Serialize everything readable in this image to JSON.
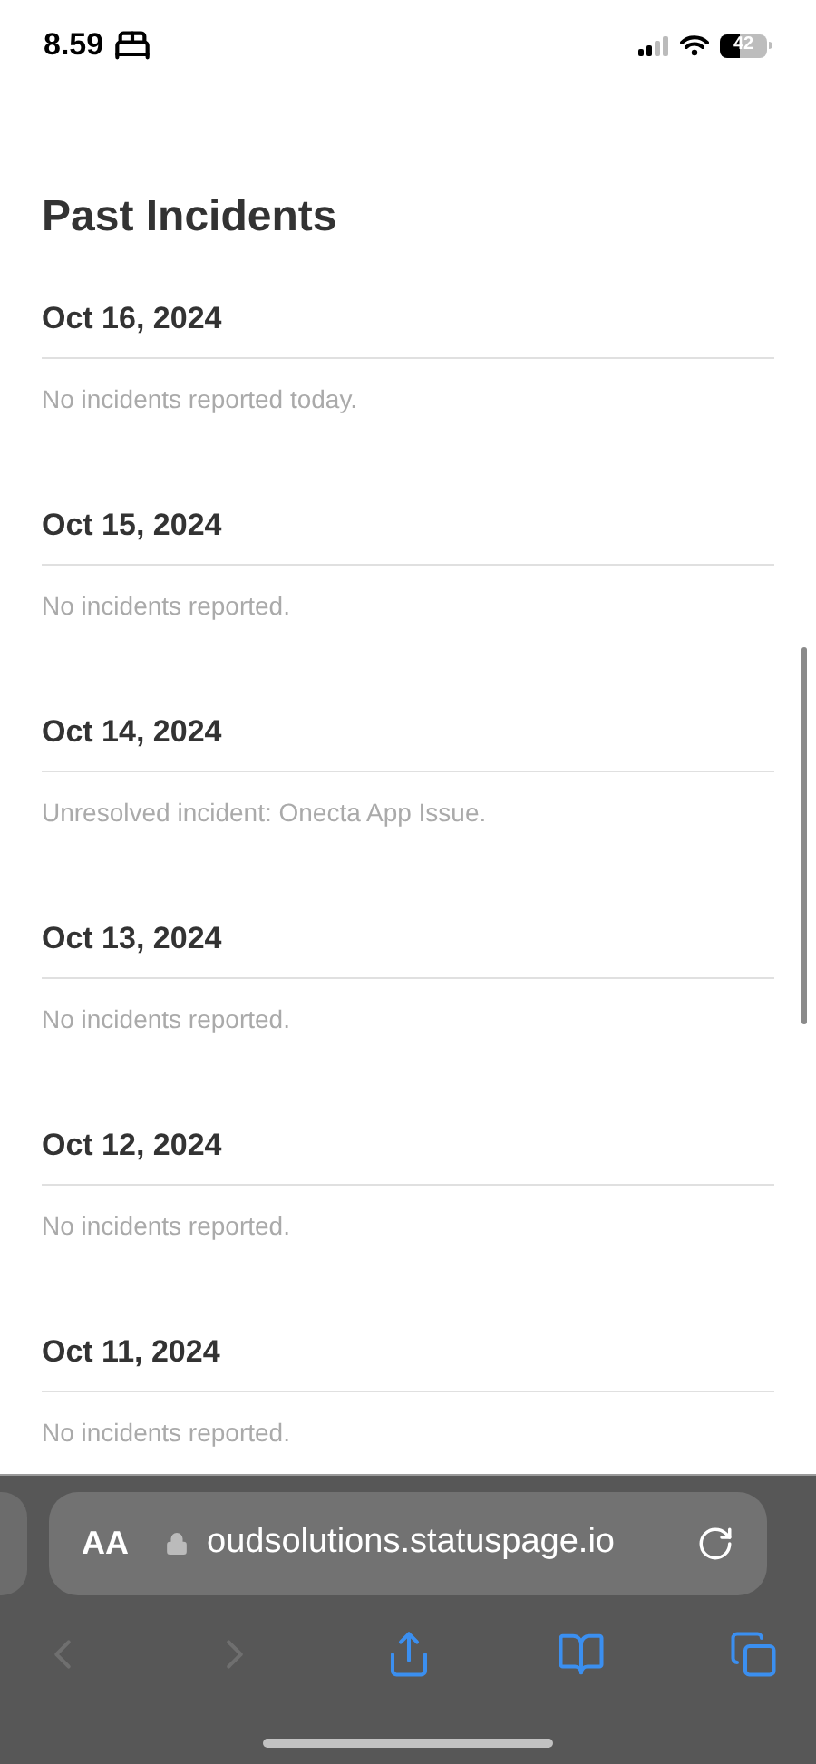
{
  "status_bar": {
    "time": "8.59",
    "battery": "42"
  },
  "page": {
    "title": "Past Incidents",
    "days": [
      {
        "date": "Oct 16, 2024",
        "note": "No incidents reported today."
      },
      {
        "date": "Oct 15, 2024",
        "note": "No incidents reported."
      },
      {
        "date": "Oct 14, 2024",
        "note": "Unresolved incident: Onecta App Issue."
      },
      {
        "date": "Oct 13, 2024",
        "note": "No incidents reported."
      },
      {
        "date": "Oct 12, 2024",
        "note": "No incidents reported."
      },
      {
        "date": "Oct 11, 2024",
        "note": "No incidents reported."
      }
    ]
  },
  "browser": {
    "text_size": "AA",
    "url": "oudsolutions.statuspage.io",
    "toolbar": [
      {
        "kind": "back",
        "disabled": true
      },
      {
        "kind": "forward",
        "disabled": true
      },
      {
        "kind": "share",
        "disabled": false
      },
      {
        "kind": "bookmarks",
        "disabled": false
      },
      {
        "kind": "tabs",
        "disabled": false
      }
    ]
  }
}
